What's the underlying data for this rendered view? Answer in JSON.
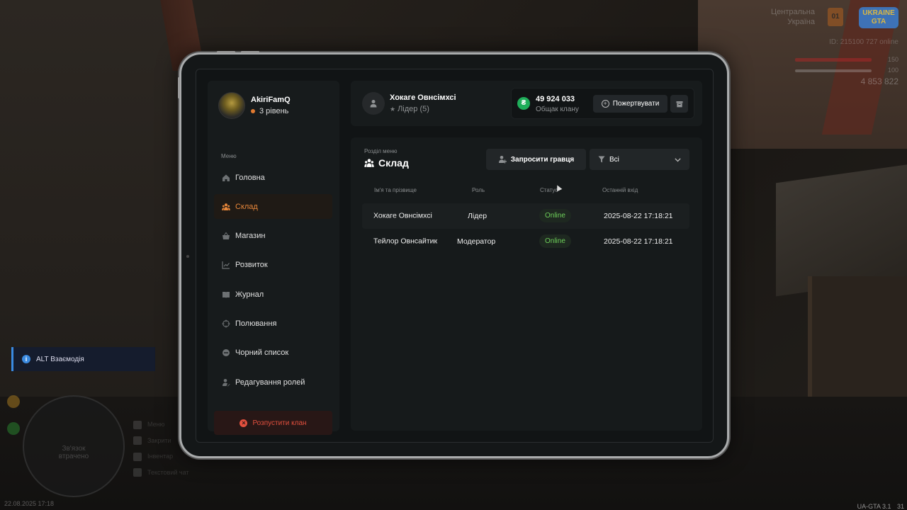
{
  "hud": {
    "region_line1": "Центральна",
    "region_line2": "Україна",
    "region_badge": "01",
    "logo_text": "UKRAINE GTA",
    "id_line": "ID: 215100  727 online",
    "hp": "150",
    "armor": "100",
    "money": "4 853 822",
    "alt_hint": "ALT Взаємодія",
    "minimap_line1": "Зв'язок",
    "minimap_line2": "втрачено",
    "key_hint_1": "Меню",
    "key_hint_2": "Закрити",
    "key_hint_3": "Інвентар",
    "key_hint_4": "Текстовий чат",
    "datetime": "22.08.2025 17:18",
    "version": "UA-GTA 3.1",
    "fps": "31",
    "colors": {
      "hp": "#aa2828",
      "alt_accent": "#3a8ae0"
    }
  },
  "sidebar": {
    "profile_name": "AkiriFamQ",
    "profile_level": "3 рівень",
    "menu_caption": "Меню",
    "items": [
      {
        "label": "Головна",
        "icon": "home-icon"
      },
      {
        "label": "Склад",
        "icon": "users-icon",
        "active": true
      },
      {
        "label": "Магазин",
        "icon": "basket-icon"
      },
      {
        "label": "Розвиток",
        "icon": "chart-icon"
      },
      {
        "label": "Журнал",
        "icon": "book-icon"
      },
      {
        "label": "Полювання",
        "icon": "crosshair-icon"
      },
      {
        "label": "Чорний список",
        "icon": "minus-circle-icon"
      },
      {
        "label": "Редагування ролей",
        "icon": "user-edit-icon"
      }
    ],
    "dissolve_label": "Розпустити клан"
  },
  "header": {
    "member_name": "Хокаге Овнсімхсі",
    "member_role": "Лідер (5)",
    "bank_amount": "49 924 033",
    "bank_label": "Общак клану",
    "donate_label": "Пожертвувати"
  },
  "content": {
    "section_caption": "Розділ меню",
    "section_title": "Склад",
    "invite_label": "Запросити гравця",
    "filter_value": "Всі",
    "columns": {
      "name": "Ім'я та прізвище",
      "role": "Роль",
      "status": "Статус",
      "last_login": "Останній вхід"
    },
    "rows": [
      {
        "name": "Хокаге Овнсімхсі",
        "role": "Лідер",
        "status": "Online",
        "last_login": "2025-08-22 17:18:21"
      },
      {
        "name": "Тейлор Овнсайтик",
        "role": "Модератор",
        "status": "Online",
        "last_login": "2025-08-22 17:18:21"
      }
    ]
  },
  "colors": {
    "accent": "#e8873a",
    "danger": "#e4503e",
    "online": "#6ed05a",
    "bank": "#1fae5a"
  }
}
